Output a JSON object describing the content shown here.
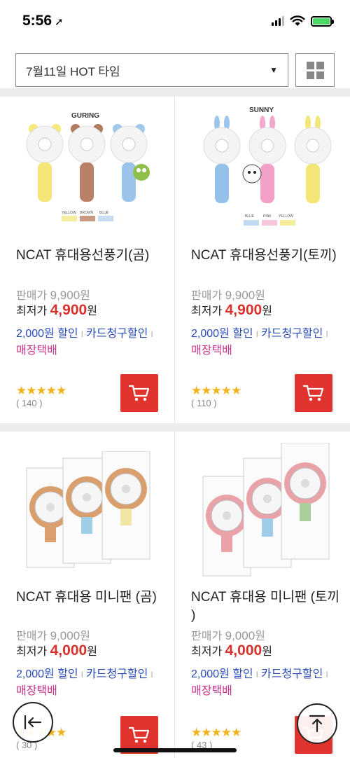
{
  "status": {
    "time": "5:56",
    "location_arrow": "➚"
  },
  "filter": {
    "selected": "7월11일 HOT 타임",
    "caret": "▼",
    "grid_icon": "grid-view-icon"
  },
  "products": [
    {
      "image_label": "GURING",
      "color_labels": [
        "YELLOW",
        "BROWN",
        "BLUE"
      ],
      "name": "NCAT 휴대용선풍기(곰)",
      "price_label": "판매가",
      "price_value": "9,900",
      "price_unit": "원",
      "best_label": "최저가",
      "best_value": "4,900",
      "best_unit": "원",
      "discount": "2,000원 할인",
      "card_discount": "카드청구할인",
      "shipping": "매장택배",
      "stars": "★★★★★",
      "reviews": "( 140 )",
      "rating_fraction": 1.0
    },
    {
      "image_label": "SUNNY",
      "color_labels": [
        "BLUE",
        "PINK",
        "YELLOW"
      ],
      "name": "NCAT 휴대용선풍기(토끼)",
      "price_label": "판매가",
      "price_value": "9,900",
      "price_unit": "원",
      "best_label": "최저가",
      "best_value": "4,900",
      "best_unit": "원",
      "discount": "2,000원 할인",
      "card_discount": "카드청구할인",
      "shipping": "매장택배",
      "stars": "★★★★★",
      "reviews": "( 110 )",
      "rating_fraction": 1.0
    },
    {
      "name": "NCAT 휴대용 미니팬 (곰)",
      "price_label": "판매가",
      "price_value": "9,000",
      "price_unit": "원",
      "best_label": "최저가",
      "best_value": "4,000",
      "best_unit": "원",
      "discount": "2,000원 할인",
      "card_discount": "카드청구할인",
      "shipping": "매장택배",
      "stars": "★★★★★",
      "reviews": "( 30 )",
      "rating_fraction": 1.0
    },
    {
      "name": "NCAT 휴대용 미니팬 (토끼 )",
      "price_label": "판매가",
      "price_value": "9,000",
      "price_unit": "원",
      "best_label": "최저가",
      "best_value": "4,000",
      "best_unit": "원",
      "discount": "2,000원 할인",
      "card_discount": "카드청구할인",
      "shipping": "매장택배",
      "stars": "★★★★★",
      "reviews": "( 43 )",
      "rating_fraction": 1.0
    }
  ],
  "colors": {
    "accent": "#e1332d",
    "price_red": "#d7322c",
    "link_blue": "#2a4cb8",
    "ship_magenta": "#c8338e",
    "star": "#f1b31c"
  },
  "fabs": {
    "back_icon": "back-to-start-icon",
    "top_icon": "scroll-to-top-icon"
  }
}
